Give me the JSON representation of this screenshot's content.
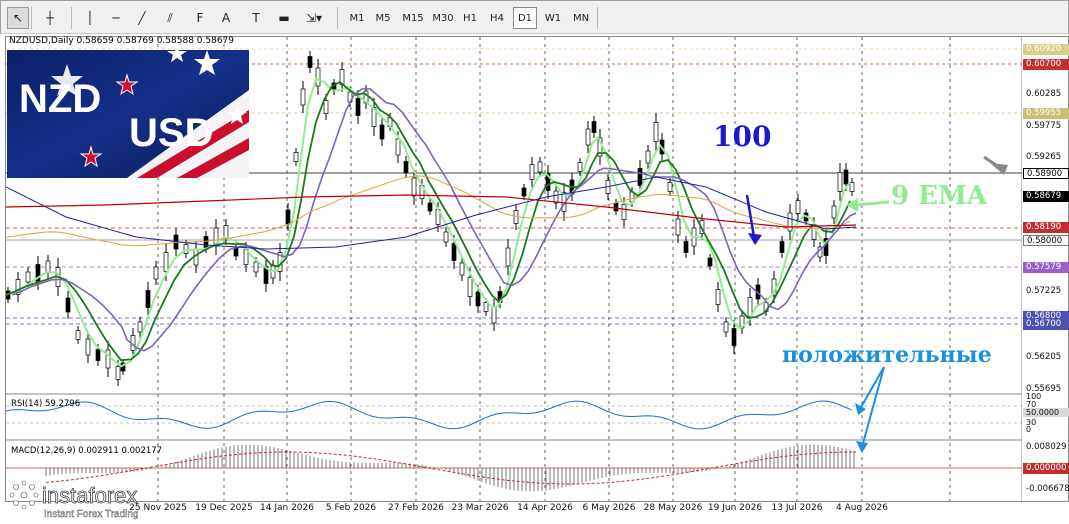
{
  "toolbar": {
    "tools": [
      {
        "name": "cursor-icon",
        "glyph": "↖"
      },
      {
        "name": "crosshair-icon",
        "glyph": "┼"
      },
      {
        "name": "vertical-line-icon",
        "glyph": "│"
      },
      {
        "name": "horizontal-line-icon",
        "glyph": "─"
      },
      {
        "name": "trendline-icon",
        "glyph": "╱"
      },
      {
        "name": "channel-icon",
        "glyph": "⫽"
      },
      {
        "name": "fibonacci-icon",
        "glyph": "F"
      },
      {
        "name": "text-icon",
        "glyph": "A"
      },
      {
        "name": "text-label-icon",
        "glyph": "T"
      },
      {
        "name": "rectangle-icon",
        "glyph": "▬"
      },
      {
        "name": "arrows-dropdown-icon",
        "glyph": "⇲▾"
      }
    ],
    "timeframes": [
      "M1",
      "M5",
      "M15",
      "M30",
      "H1",
      "H4",
      "D1",
      "W1",
      "MN"
    ],
    "active_timeframe": "D1"
  },
  "chart": {
    "title": "NZDUSD,Daily  0.58659 0.58769 0.58588 0.58679",
    "flag_text_top": "NZD",
    "flag_text_bottom": "USD",
    "price_axis": [
      "0.60920",
      "0.60700",
      "0.60285",
      "0.59955",
      "0.59775",
      "0.59265",
      "0.58900",
      "0.58679",
      "0.58190",
      "0.58000",
      "0.57579",
      "0.57225",
      "0.56800",
      "0.56700",
      "0.56205",
      "0.55695"
    ],
    "x_axis": [
      "25 Nov 2025",
      "19 Dec 2025",
      "14 Jan 2026",
      "5 Feb 2026",
      "27 Feb 2026",
      "23 Mar 2026",
      "14 Apr 2026",
      "6 May 2026",
      "28 May 2026",
      "19 Jun 2026",
      "13 Jul 2026",
      "4 Aug 2026"
    ],
    "annotations": {
      "ema100": "100",
      "ema9": "9 EMA",
      "positive": "положительные"
    },
    "colors": {
      "ema9": "#90ee90",
      "sma_dark_green": "#1a7a1a",
      "sma_purple": "#8060c0",
      "ema100_blue": "#2020a0",
      "ema200_red": "#c00000",
      "ema_orange": "#e0a040",
      "annotation_blue": "#1a1acc",
      "annotation_cyan": "#1a90e0"
    }
  },
  "rsi": {
    "title": "RSI(14) 59.2796",
    "axis": [
      "100",
      "70",
      "50.0000",
      "30",
      "0"
    ]
  },
  "macd": {
    "title": "MACD(12,26,9) 0.002911 0.002177",
    "axis": [
      "0.008029",
      "0.000000",
      "-0.006678"
    ]
  },
  "watermark": {
    "brand": "instaforex",
    "tagline": "Instant Forex Trading"
  }
}
